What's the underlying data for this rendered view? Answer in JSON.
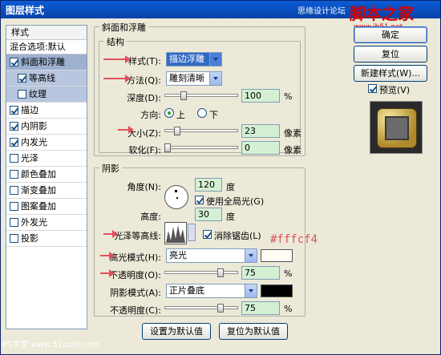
{
  "window": {
    "title": "图层样式"
  },
  "watermark": {
    "site": "思缘设计论坛",
    "logo": "脚本之家",
    "url": "www.jb51.net",
    "bottom": "PS学堂 www.52psxt.com"
  },
  "sidebar": {
    "header": "样式",
    "blend": "混合选项:默认",
    "items": [
      {
        "label": "斜面和浮雕",
        "checked": true,
        "selected": true,
        "sub": false
      },
      {
        "label": "等高线",
        "checked": true,
        "selected": true,
        "sub": true
      },
      {
        "label": "纹理",
        "checked": false,
        "selected": true,
        "sub": true
      },
      {
        "label": "描边",
        "checked": true,
        "selected": false,
        "sub": false
      },
      {
        "label": "内阴影",
        "checked": true,
        "selected": false,
        "sub": false
      },
      {
        "label": "内发光",
        "checked": true,
        "selected": false,
        "sub": false
      },
      {
        "label": "光泽",
        "checked": false,
        "selected": false,
        "sub": false
      },
      {
        "label": "颜色叠加",
        "checked": false,
        "selected": false,
        "sub": false
      },
      {
        "label": "渐变叠加",
        "checked": false,
        "selected": false,
        "sub": false
      },
      {
        "label": "图案叠加",
        "checked": false,
        "selected": false,
        "sub": false
      },
      {
        "label": "外发光",
        "checked": false,
        "selected": false,
        "sub": false
      },
      {
        "label": "投影",
        "checked": false,
        "selected": false,
        "sub": false
      }
    ]
  },
  "bevel": {
    "title": "斜面和浮雕",
    "structure_title": "结构",
    "style_label": "样式(T):",
    "style_value": "描边浮雕",
    "technique_label": "方法(Q):",
    "technique_value": "雕刻清晰",
    "depth_label": "深度(D):",
    "depth_value": "100",
    "depth_unit": "%",
    "direction_label": "方向:",
    "dir_up": "上",
    "dir_down": "下",
    "size_label": "大小(Z):",
    "size_value": "23",
    "size_unit": "像素",
    "soften_label": "软化(F):",
    "soften_value": "0",
    "soften_unit": "像素"
  },
  "shading": {
    "title": "阴影",
    "angle_label": "角度(N):",
    "angle_value": "120",
    "angle_unit": "度",
    "global_light": "使用全局光(G)",
    "altitude_label": "高度:",
    "altitude_value": "30",
    "altitude_unit": "度",
    "gloss_label": "光泽等高线:",
    "antialias": "消除锯齿(L)",
    "highlight_label": "高光模式(H):",
    "highlight_value": "亮光",
    "highlight_color": "#fffcf4",
    "hl_opacity_label": "不透明度(O):",
    "hl_opacity_value": "75",
    "hl_opacity_unit": "%",
    "shadow_label": "阴影模式(A):",
    "shadow_value": "正片叠底",
    "shadow_color": "#000000",
    "sh_opacity_label": "不透明度(C):",
    "sh_opacity_value": "75",
    "sh_opacity_unit": "%"
  },
  "buttons": {
    "ok": "确定",
    "reset": "复位",
    "new_style": "新建样式(W)...",
    "preview": "预览(V)",
    "set_default": "设置为默认值",
    "reset_default": "复位为默认值"
  },
  "annotation": "#fffcf4"
}
